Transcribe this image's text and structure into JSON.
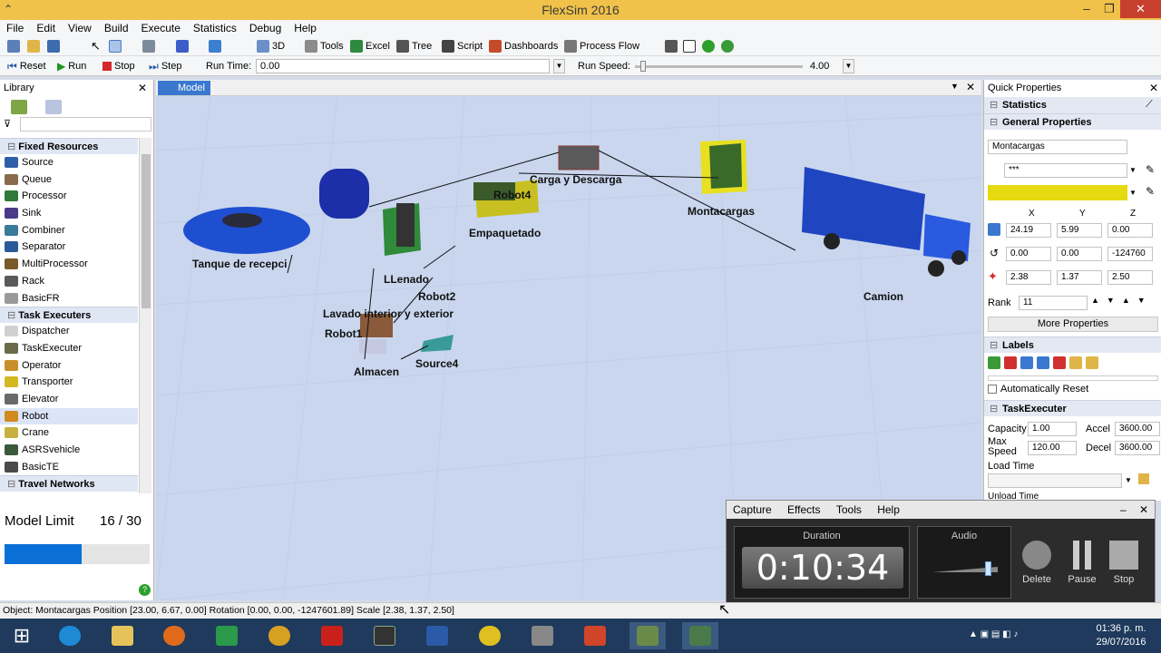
{
  "window": {
    "title": "FlexSim 2016"
  },
  "menu": [
    "File",
    "Edit",
    "View",
    "Build",
    "Execute",
    "Statistics",
    "Debug",
    "Help"
  ],
  "toolbar": {
    "view3d": "3D",
    "tools": "Tools",
    "excel": "Excel",
    "tree": "Tree",
    "script": "Script",
    "dashboards": "Dashboards",
    "process_flow": "Process Flow"
  },
  "runbar": {
    "reset": "Reset",
    "run": "Run",
    "stop": "Stop",
    "step": "Step",
    "run_time_label": "Run Time:",
    "run_time": "0.00",
    "run_speed_label": "Run Speed:",
    "run_speed": "4.00",
    "speed_level": 0.05
  },
  "library": {
    "title": "Library",
    "sections": [
      {
        "name": "Fixed Resources",
        "items": [
          "Source",
          "Queue",
          "Processor",
          "Sink",
          "Combiner",
          "Separator",
          "MultiProcessor",
          "Rack",
          "BasicFR"
        ]
      },
      {
        "name": "Task Executers",
        "items": [
          "Dispatcher",
          "TaskExecuter",
          "Operator",
          "Transporter",
          "Elevator",
          "Robot",
          "Crane",
          "ASRSvehicle",
          "BasicTE"
        ]
      },
      {
        "name": "Travel Networks",
        "items": []
      }
    ],
    "selected": "Robot"
  },
  "model_limit": {
    "label": "Model Limit",
    "value": "16 / 30",
    "fraction": 0.53
  },
  "model_tab": "Model",
  "model_labels": {
    "tanque": "Tanque de recepci",
    "robot4": "Robot4",
    "carga": "Carga y Descarga",
    "montacargas": "Montacargas",
    "empaquetado": "Empaquetado",
    "llenado": "LLenado",
    "robot2": "Robot2",
    "lavado": "Lavado interior y exterior",
    "robot1": "Robot1",
    "almacen": "Almacen",
    "source4": "Source4",
    "camion": "Camion"
  },
  "quick": {
    "title": "Quick Properties",
    "statistics": "Statistics",
    "general": "General Properties",
    "name": "Montacargas",
    "shape": "***",
    "color": "#e6da10",
    "axes": [
      "X",
      "Y",
      "Z"
    ],
    "pos": [
      "24.19",
      "5.99",
      "0.00"
    ],
    "rot": [
      "0.00",
      "0.00",
      "-124760"
    ],
    "size": [
      "2.38",
      "1.37",
      "2.50"
    ],
    "rank_label": "Rank",
    "rank": "11",
    "more": "More Properties",
    "labels": "Labels",
    "auto_reset": "Automatically Reset",
    "task_exec": "TaskExecuter",
    "capacity_label": "Capacity",
    "capacity": "1.00",
    "accel_label": "Accel",
    "accel": "3600.00",
    "maxspeed_label": "Max Speed",
    "maxspeed": "120.00",
    "decel_label": "Decel",
    "decel": "3600.00",
    "load_time": "Load Time",
    "unload_time": "Unload Time"
  },
  "status_text": "Object: Montacargas Position [23.00, 6.67, 0.00]  Rotation [0.00, 0.00, -1247601.89]  Scale [2.38, 1.37, 2.50]",
  "recorder": {
    "menu": [
      "Capture",
      "Effects",
      "Tools",
      "Help"
    ],
    "duration_label": "Duration",
    "duration": "0:10:34",
    "audio_label": "Audio",
    "audio_level": 0.8,
    "delete": "Delete",
    "pause": "Pause",
    "stop": "Stop"
  },
  "clock": {
    "time": "01:36 p. m.",
    "date": "29/07/2016"
  }
}
